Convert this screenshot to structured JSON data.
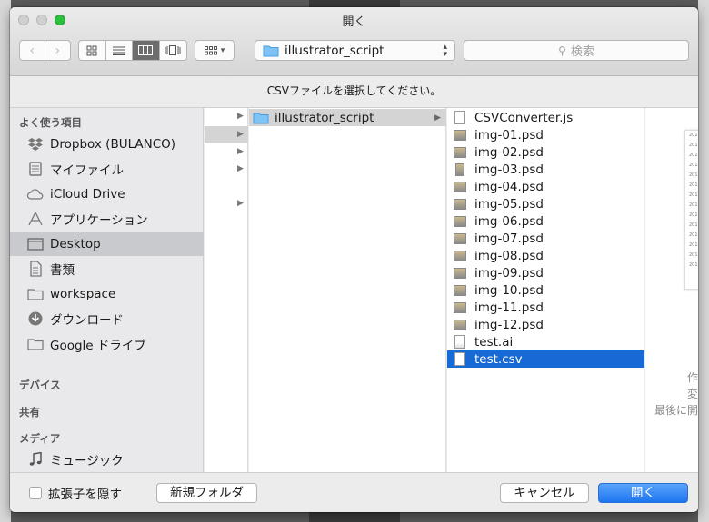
{
  "window": {
    "title": "開く"
  },
  "toolbar": {
    "path_popup_label": "illustrator_script",
    "search_placeholder": "検索"
  },
  "prompt": "CSVファイルを選択してください。",
  "sidebar": {
    "favorites_header": "よく使う項目",
    "favorites": [
      {
        "label": "Dropbox (BULANCO)",
        "icon": "dropbox-icon"
      },
      {
        "label": "マイファイル",
        "icon": "all-my-files-icon"
      },
      {
        "label": "iCloud Drive",
        "icon": "cloud-icon"
      },
      {
        "label": "アプリケーション",
        "icon": "applications-icon"
      },
      {
        "label": "Desktop",
        "icon": "desktop-icon"
      },
      {
        "label": "書類",
        "icon": "documents-icon"
      },
      {
        "label": "workspace",
        "icon": "folder-icon"
      },
      {
        "label": "ダウンロード",
        "icon": "download-icon"
      },
      {
        "label": "Google ドライブ",
        "icon": "folder-icon"
      }
    ],
    "devices_header": "デバイス",
    "shared_header": "共有",
    "media_header": "メディア",
    "media": [
      {
        "label": "ミュージック",
        "icon": "music-icon"
      }
    ]
  },
  "columns": {
    "col2_folder": "illustrator_script",
    "files": [
      {
        "name": "CSVConverter.js",
        "icon": "js-document-icon"
      },
      {
        "name": "img-01.psd",
        "icon": "psd-thumbnail-icon"
      },
      {
        "name": "img-02.psd",
        "icon": "psd-thumbnail-icon"
      },
      {
        "name": "img-03.psd",
        "icon": "psd-thumbnail-icon"
      },
      {
        "name": "img-04.psd",
        "icon": "psd-thumbnail-icon"
      },
      {
        "name": "img-05.psd",
        "icon": "psd-thumbnail-icon"
      },
      {
        "name": "img-06.psd",
        "icon": "psd-thumbnail-icon"
      },
      {
        "name": "img-07.psd",
        "icon": "psd-thumbnail-icon"
      },
      {
        "name": "img-08.psd",
        "icon": "psd-thumbnail-icon"
      },
      {
        "name": "img-09.psd",
        "icon": "psd-thumbnail-icon"
      },
      {
        "name": "img-10.psd",
        "icon": "psd-thumbnail-icon"
      },
      {
        "name": "img-11.psd",
        "icon": "psd-thumbnail-icon"
      },
      {
        "name": "img-12.psd",
        "icon": "psd-thumbnail-icon"
      },
      {
        "name": "test.ai",
        "icon": "ai-document-icon"
      },
      {
        "name": "test.csv",
        "icon": "csv-document-icon",
        "selected": true
      }
    ]
  },
  "preview": {
    "info_lines": [
      "作",
      "変",
      "最後に開"
    ]
  },
  "bottom": {
    "hide_extension_label": "拡張子を隠す",
    "new_folder_label": "新規フォルダ",
    "cancel_label": "キャンセル",
    "open_label": "開く"
  }
}
